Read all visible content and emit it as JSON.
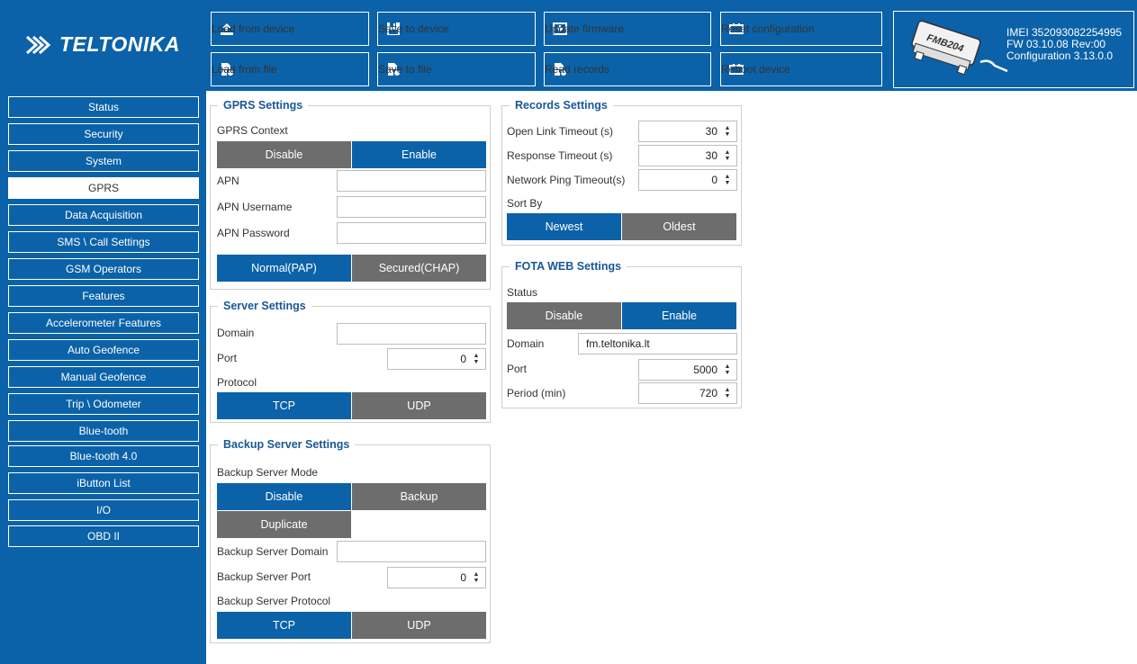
{
  "header": {
    "logo_text": "TELTONIKA",
    "buttons": {
      "load_device": "Load from device",
      "save_device": "Save to device",
      "update_fw": "Update firmware",
      "reset_config": "Reset configuration",
      "load_file": "Load from file",
      "save_file": "Save to file",
      "read_records": "Read records",
      "reboot": "Reboot device"
    },
    "device": {
      "model": "FMB204",
      "imei": "IMEI 352093082254995",
      "fw": "FW 03.10.08 Rev:00",
      "config": "Configuration 3.13.0.0"
    }
  },
  "sidebar": {
    "items": [
      {
        "label": "Status"
      },
      {
        "label": "Security"
      },
      {
        "label": "System"
      },
      {
        "label": "GPRS"
      },
      {
        "label": "Data Acquisition"
      },
      {
        "label": "SMS \\ Call Settings"
      },
      {
        "label": "GSM Operators"
      },
      {
        "label": "Features"
      },
      {
        "label": "Accelerometer Features"
      },
      {
        "label": "Auto Geofence"
      },
      {
        "label": "Manual Geofence"
      },
      {
        "label": "Trip \\ Odometer"
      },
      {
        "label": "Blue-tooth"
      },
      {
        "label": "Blue-tooth 4.0"
      },
      {
        "label": "iButton List"
      },
      {
        "label": "I/O"
      },
      {
        "label": "OBD II"
      }
    ],
    "active": "GPRS"
  },
  "gprs": {
    "title": "GPRS Settings",
    "context_label": "GPRS Context",
    "disable": "Disable",
    "enable": "Enable",
    "apn_label": "APN",
    "apn_value": "",
    "apn_user_label": "APN Username",
    "apn_user_value": "",
    "apn_pass_label": "APN Password",
    "apn_pass_value": "",
    "auth_pap": "Normal(PAP)",
    "auth_chap": "Secured(CHAP)"
  },
  "server": {
    "title": "Server Settings",
    "domain_label": "Domain",
    "domain_value": "",
    "port_label": "Port",
    "port_value": "0",
    "protocol_label": "Protocol",
    "tcp": "TCP",
    "udp": "UDP"
  },
  "backup": {
    "title": "Backup Server Settings",
    "mode_label": "Backup Server Mode",
    "disable": "Disable",
    "backup": "Backup",
    "duplicate": "Duplicate",
    "domain_label": "Backup Server Domain",
    "domain_value": "",
    "port_label": "Backup Server Port",
    "port_value": "0",
    "protocol_label": "Backup Server Protocol",
    "tcp": "TCP",
    "udp": "UDP"
  },
  "records": {
    "title": "Records Settings",
    "open_link_label": "Open Link Timeout (s)",
    "open_link_value": "30",
    "response_label": "Response Timeout (s)",
    "response_value": "30",
    "ping_label": "Network Ping Timeout(s)",
    "ping_value": "0",
    "sort_label": "Sort By",
    "newest": "Newest",
    "oldest": "Oldest"
  },
  "fota": {
    "title": "FOTA WEB Settings",
    "status_label": "Status",
    "disable": "Disable",
    "enable": "Enable",
    "domain_label": "Domain",
    "domain_value": "fm.teltonika.lt",
    "port_label": "Port",
    "port_value": "5000",
    "period_label": "Period (min)",
    "period_value": "720"
  },
  "colors": {
    "brand_blue": "#0b62a8",
    "toggle_off": "#6d6d6d",
    "group_title": "#1a5796"
  }
}
